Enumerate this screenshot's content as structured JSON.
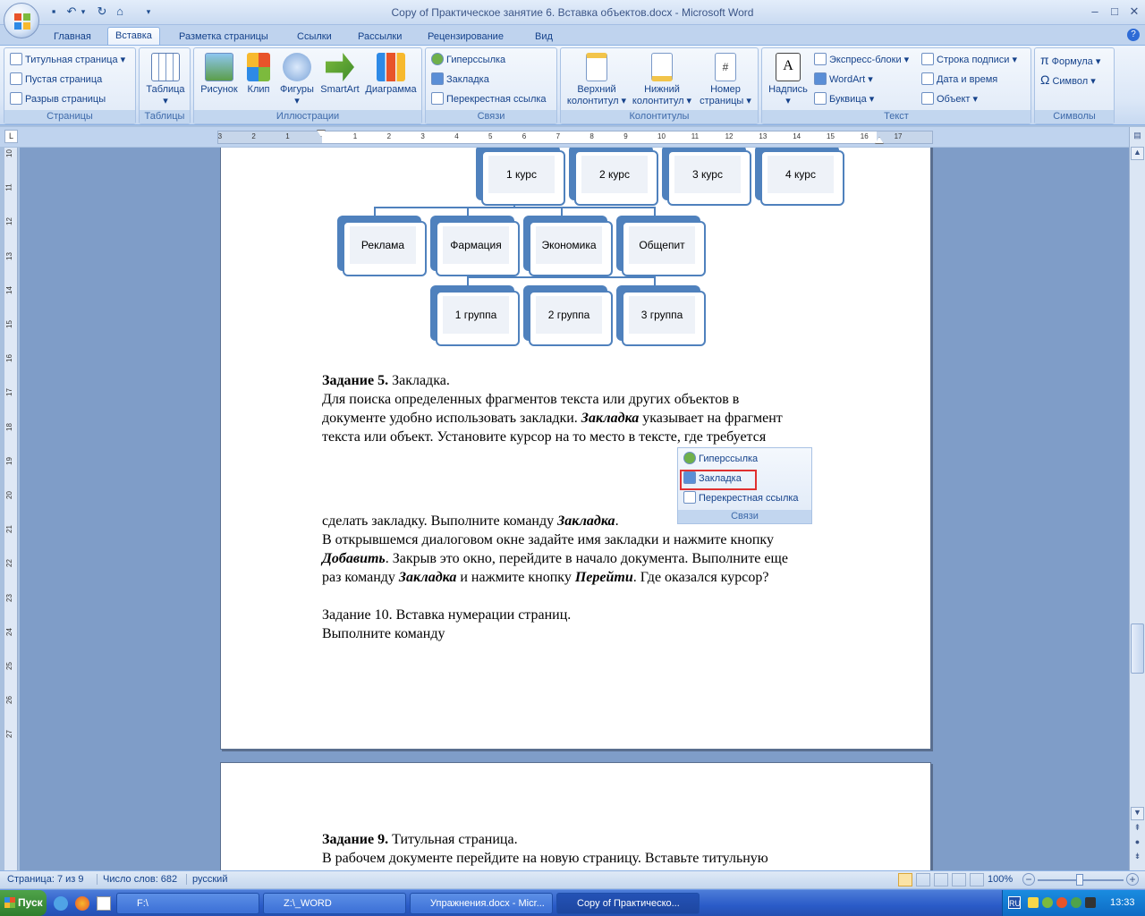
{
  "window": {
    "title": "Copy of Практическое занятие 6. Вставка объектов.docx - Microsoft Word",
    "controls": {
      "minimize": "–",
      "maximize": "□",
      "close": "✕"
    }
  },
  "qat": {
    "save": "save-icon",
    "undo": "undo-icon",
    "redo": "redo-icon",
    "open": "open-icon"
  },
  "tabs": [
    "Главная",
    "Вставка",
    "Разметка страницы",
    "Ссылки",
    "Рассылки",
    "Рецензирование",
    "Вид"
  ],
  "active_tab": "Вставка",
  "ribbon": {
    "pages": {
      "label": "Страницы",
      "items": [
        "Титульная страница",
        "Пустая страница",
        "Разрыв страницы"
      ]
    },
    "tables": {
      "label": "Таблицы",
      "items": [
        "Таблица"
      ]
    },
    "illustrations": {
      "label": "Иллюстрации",
      "items": [
        "Рисунок",
        "Клип",
        "Фигуры",
        "SmartArt",
        "Диаграмма"
      ]
    },
    "links": {
      "label": "Связи",
      "items": [
        "Гиперссылка",
        "Закладка",
        "Перекрестная ссылка"
      ]
    },
    "headers": {
      "label": "Колонтитулы",
      "items": [
        [
          "Верхний",
          "колонтитул"
        ],
        [
          "Нижний",
          "колонтитул"
        ],
        [
          "Номер",
          "страницы"
        ]
      ]
    },
    "text": {
      "label": "Текст",
      "textbox": "Надпись",
      "items": [
        "Экспресс-блоки",
        "WordArt",
        "Буквица",
        "Строка подписи",
        "Дата и время",
        "Объект"
      ]
    },
    "symbols": {
      "label": "Символы",
      "items": [
        "Формула",
        "Символ"
      ]
    }
  },
  "ruler": {
    "numbers": [
      "3",
      "2",
      "1",
      "1",
      "2",
      "3",
      "4",
      "5",
      "6",
      "7",
      "8",
      "9",
      "10",
      "11",
      "12",
      "13",
      "14",
      "15",
      "16",
      "17"
    ]
  },
  "vruler": {
    "numbers": [
      "10",
      "11",
      "12",
      "13",
      "14",
      "15",
      "16",
      "17",
      "18",
      "19",
      "20",
      "21",
      "22",
      "23",
      "24",
      "25",
      "26",
      "27"
    ]
  },
  "diagram": {
    "row1": [
      "1 курс",
      "2 курс",
      "3 курс",
      "4 курс"
    ],
    "row2": [
      "Реклама",
      "Фармация",
      "Экономика",
      "Общепит"
    ],
    "row3": [
      "1 группа",
      "2 группа",
      "3 группа"
    ]
  },
  "page1": {
    "task5_title": "Задание 5.",
    "task5_title_rest": " Закладка.",
    "p1": "Для поиска определенных фрагментов текста или других объектов в",
    "p2a": "документе удобно использовать закладки. ",
    "p2b": "Закладка",
    "p2c": " указывает на фрагмент",
    "p3": "текста или объект. Установите курсор на то место в тексте, где требуется",
    "p4a": "сделать закладку. Выполните команду ",
    "p4b": "Закладка",
    "p4c": ".",
    "p5": " В открывшемся диалоговом окне задайте имя закладки и нажмите кнопку",
    "p6a": "Добавить",
    "p6b": ". Закрыв это окно, перейдите в начало документа. Выполните еще",
    "p7a": "раз команду ",
    "p7b": "Закладка",
    "p7c": " и нажмите кнопку ",
    "p7d": "Перейти",
    "p7e": ". Где оказался курсор?",
    "task10": "Задание 10. Вставка нумерации страниц.",
    "task10b": "Выполните команду",
    "inset": {
      "items": [
        "Гиперссылка",
        "Закладка",
        "Перекрестная ссылка"
      ],
      "label": "Связи"
    }
  },
  "page2": {
    "task9_title": "Задание 9.",
    "task9_rest": " Титульная страница.",
    "p1": "В рабочем документе перейдите на новую страницу. Вставьте титульную"
  },
  "status": {
    "page": "Страница: 7 из 9",
    "words": "Число слов: 682",
    "lang": "русский",
    "zoom": "100%"
  },
  "taskbar": {
    "start": "Пуск",
    "items": [
      "F:\\",
      "Z:\\_WORD",
      "Упражнения.docx - Micr...",
      "Copy of Практическо..."
    ],
    "lang": "RU",
    "clock": "13:33"
  },
  "colors": {
    "accent": "#4f81bd",
    "highlight": "#e03030"
  }
}
